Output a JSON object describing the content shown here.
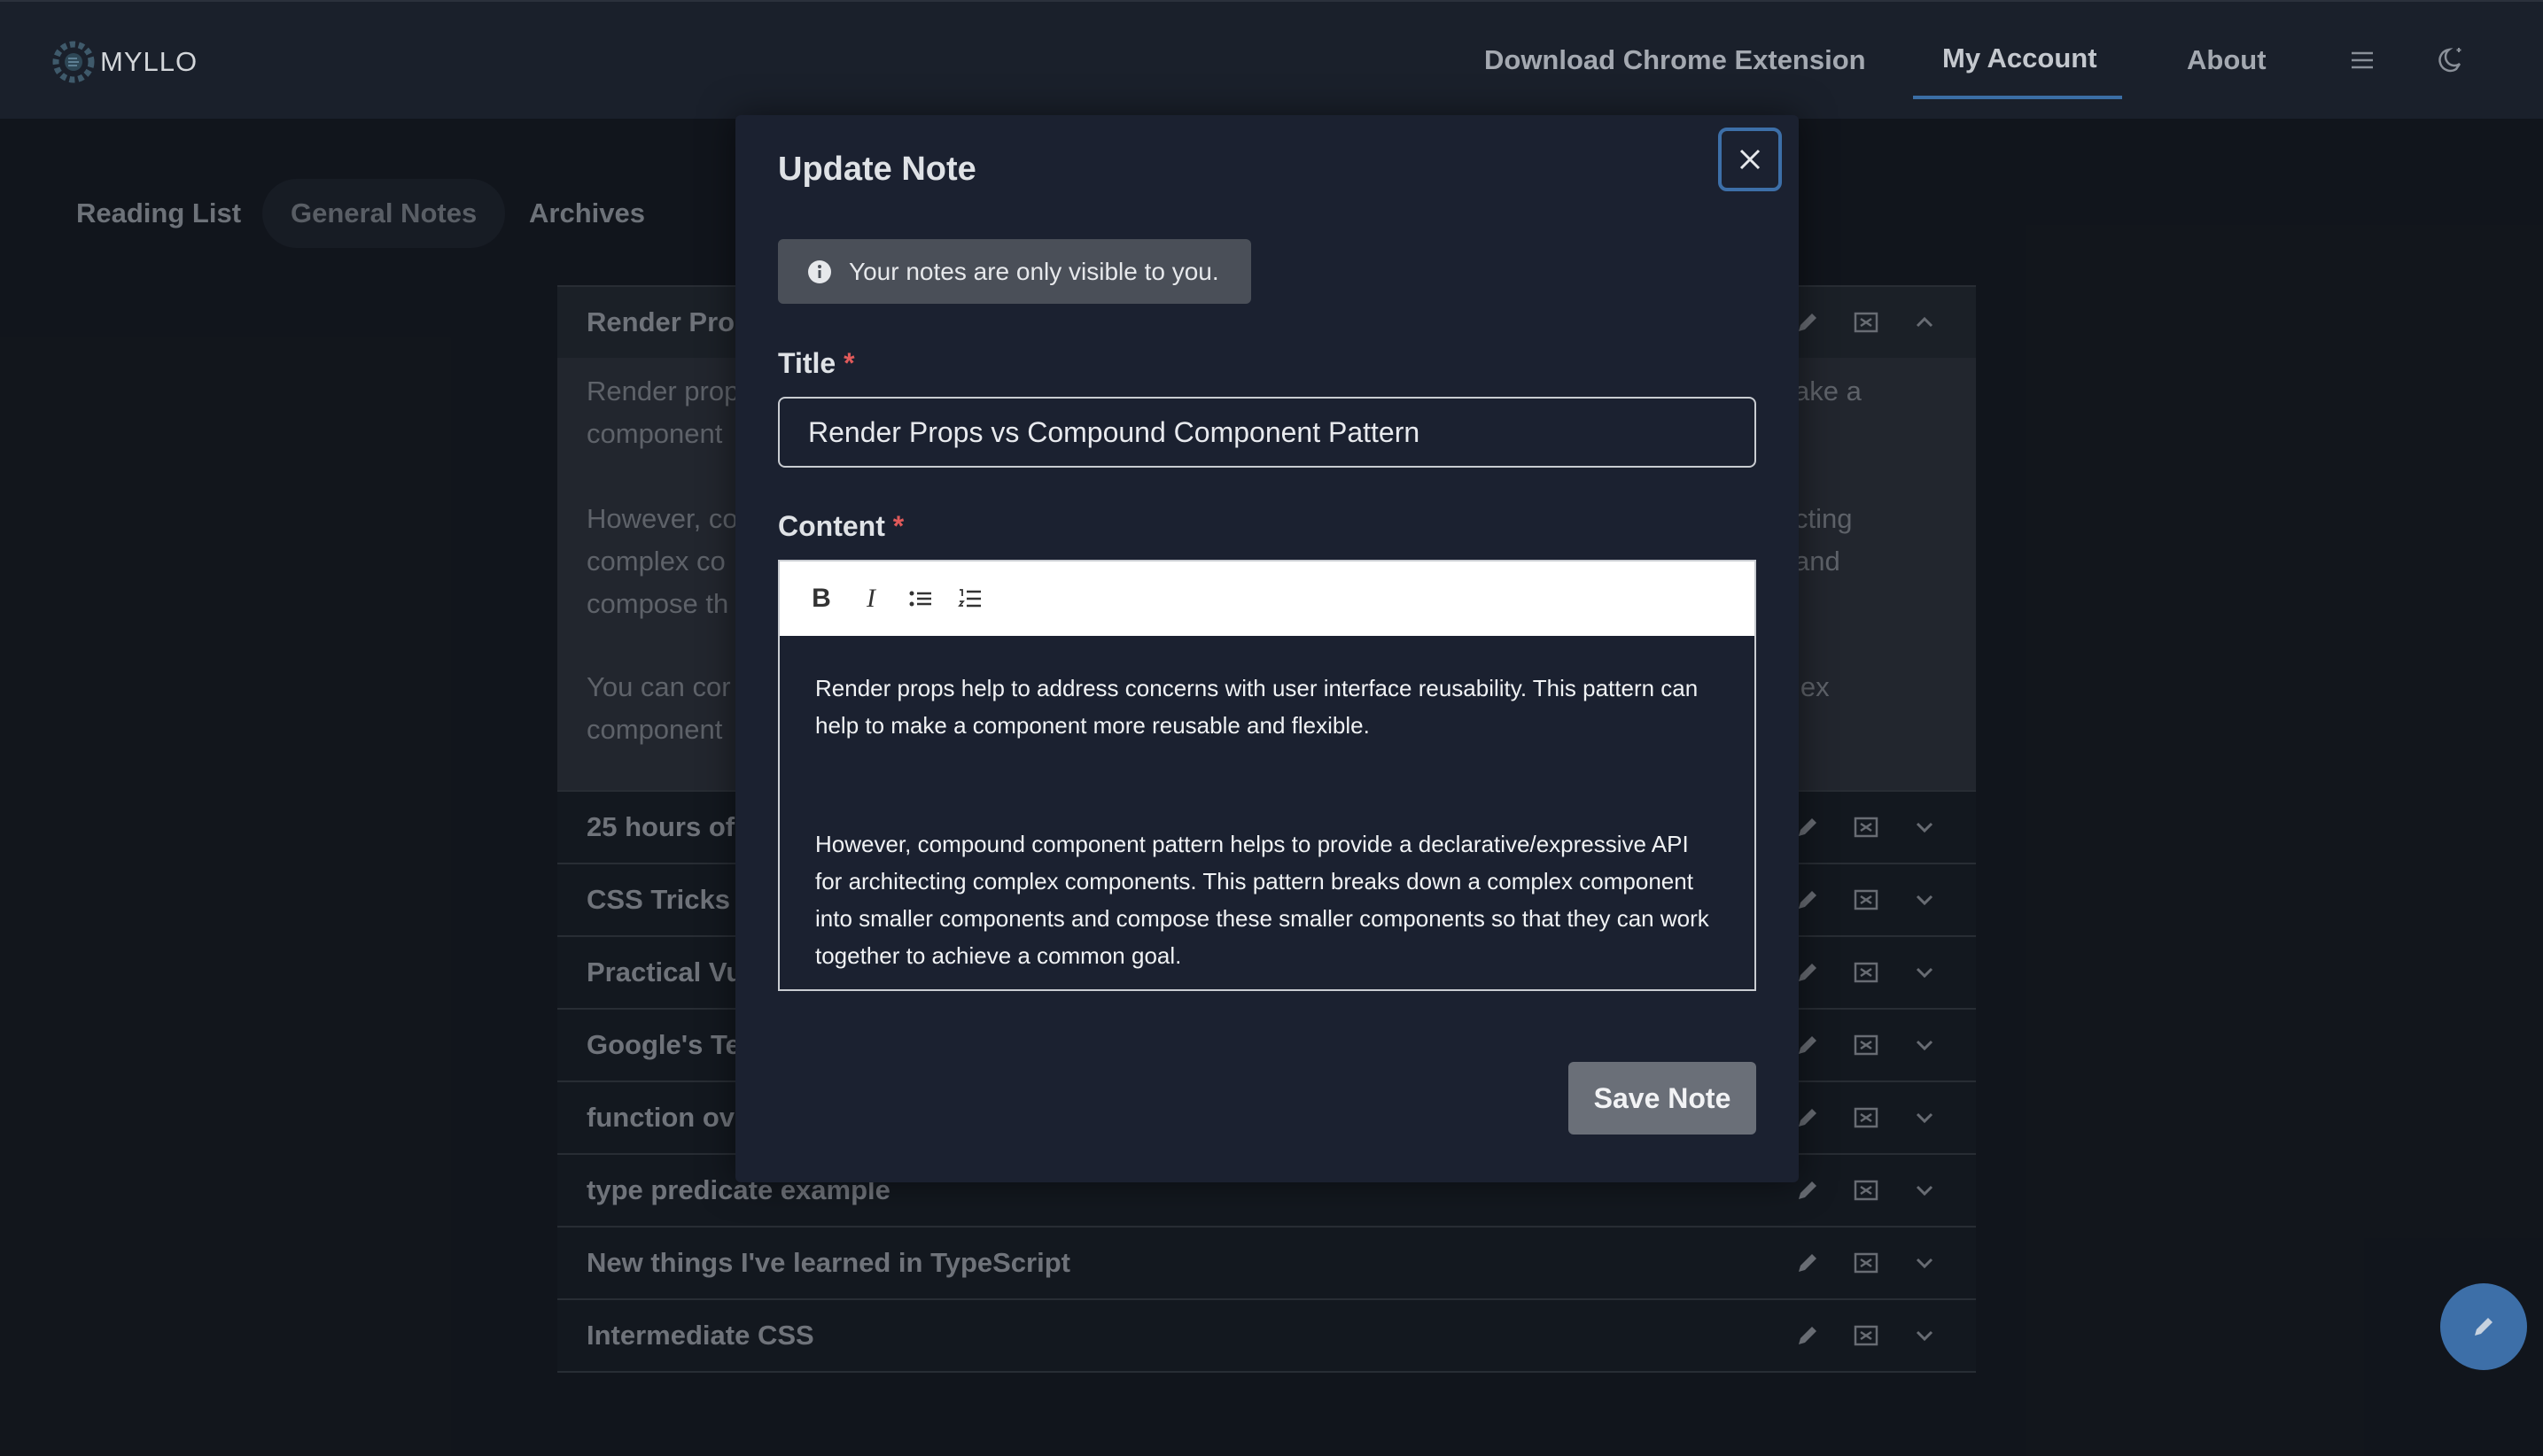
{
  "app": {
    "logo_text": "MYLLO"
  },
  "nav": {
    "download": "Download Chrome Extension",
    "account": "My Account",
    "about": "About"
  },
  "tabs": [
    "Reading List",
    "General Notes",
    "Archives"
  ],
  "notes": {
    "open": {
      "title_partial": "Render Prop",
      "body_left": [
        "Render prop",
        "component",
        "",
        "However, co",
        "complex co",
        "compose th",
        "",
        "You can cor",
        "component"
      ],
      "body_right": [
        "ake a",
        "",
        "",
        "cting",
        "and",
        "",
        "",
        "lex",
        ""
      ]
    },
    "rows": [
      "25 hours of",
      "CSS Tricks",
      "Practical Vu",
      "Google's Tec",
      "function ove",
      "type predicate example",
      "New things I've learned in TypeScript",
      "Intermediate CSS"
    ]
  },
  "modal": {
    "title": "Update Note",
    "info": "Your notes are only visible to you.",
    "title_label": "Title",
    "content_label": "Content",
    "required_mark": "*",
    "title_value": "Render Props vs Compound Component Pattern",
    "content_paragraphs": [
      "Render props help to address concerns with user interface reusability. This pattern can help to make a component more reusable and flexible.",
      "However, compound component pattern helps to provide a declarative/expressive API for architecting complex components. This pattern breaks down a complex component into smaller components and compose these smaller components so that they can work together to achieve a common goal."
    ],
    "toolbar": {
      "bold": "B",
      "italic": "I"
    },
    "save_label": "Save Note"
  },
  "colors": {
    "accent": "#3d6fa8",
    "required": "#e05a5a"
  }
}
